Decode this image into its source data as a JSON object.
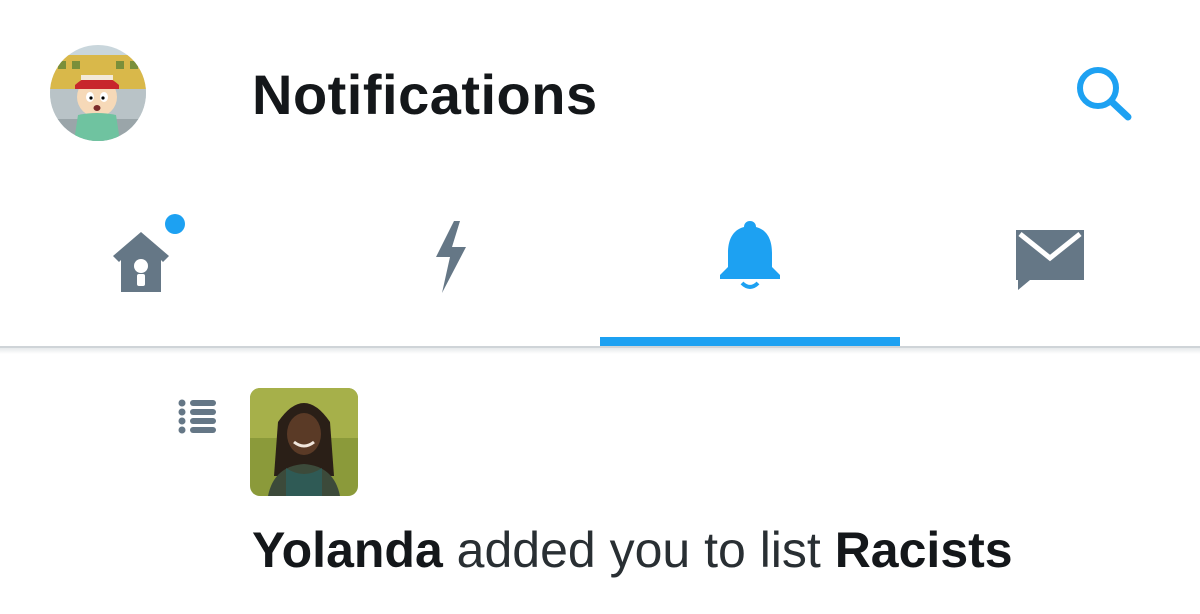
{
  "header": {
    "title": "Notifications",
    "avatar_icon": "user-avatar-cartoon",
    "search_icon": "search-icon",
    "accent_color": "#1da1f2"
  },
  "tabs": [
    {
      "name": "home",
      "icon": "home-icon",
      "has_new_dot": true,
      "active": false
    },
    {
      "name": "moments",
      "icon": "lightning-icon",
      "active": false
    },
    {
      "name": "notifications",
      "icon": "bell-icon",
      "active": true
    },
    {
      "name": "messages",
      "icon": "envelope-icon",
      "active": false
    }
  ],
  "notification": {
    "type_icon": "list-icon",
    "actor": "Yolanda",
    "action": " added you to list ",
    "list_name": "Racists"
  }
}
